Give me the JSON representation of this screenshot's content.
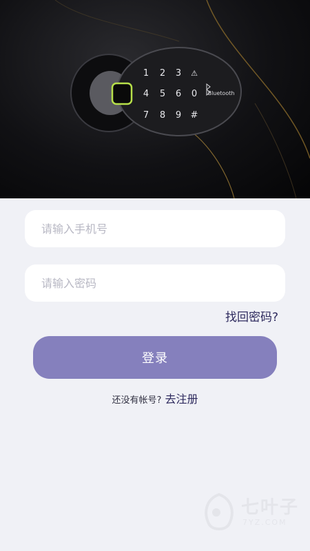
{
  "hero": {
    "keypad": {
      "keys": [
        "1",
        "2",
        "3",
        "",
        "4",
        "5",
        "6",
        "0",
        "7",
        "8",
        "9",
        "#"
      ],
      "bluetooth_label": "Bluetooth",
      "colors": {
        "fingerprint_ring": "#b7e04a",
        "body": "#1c1c1f"
      }
    }
  },
  "login_form": {
    "phone_placeholder": "请输入手机号",
    "password_placeholder": "请输入密码",
    "forgot_label": "找回密码?",
    "login_label": "登录",
    "register_question": "还没有帐号?",
    "register_link": "去注册"
  },
  "watermark": {
    "cn": "七叶子",
    "en": "7YZ.COM"
  },
  "colors": {
    "background": "#f0f1f6",
    "primary_button": "#8580bd",
    "link_text": "#2e2a5e"
  }
}
